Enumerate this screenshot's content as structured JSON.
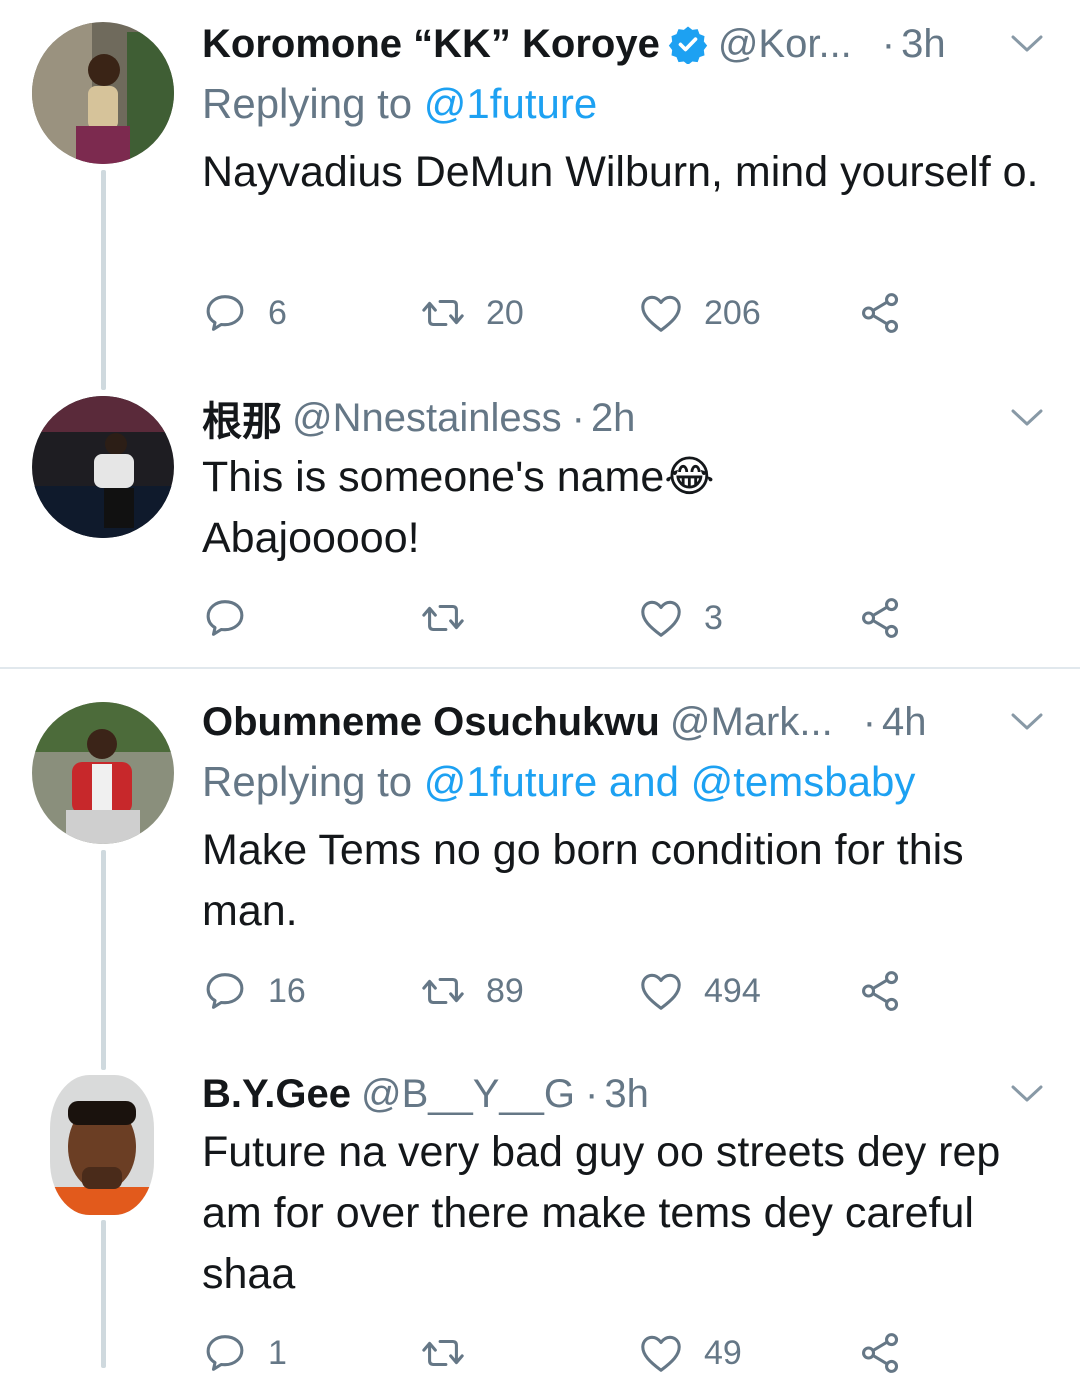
{
  "colors": {
    "accent": "#1da1f2",
    "secondary_text": "#657786",
    "primary_text": "#14171a",
    "thread_line": "#cfd9de"
  },
  "tweets": [
    {
      "name": "Koromone “KK” Koroye",
      "handle": "@Kor...",
      "sep": "·",
      "time": "3h",
      "verified": true,
      "reply_prefix": "Replying to",
      "reply_mentions": "@1future",
      "text": "Nayvadius DeMun Wilburn, mind yourself o.",
      "replies": "6",
      "retweets": "20",
      "likes": "206"
    },
    {
      "name": "根那",
      "handle": "@Nnestainless",
      "sep": "·",
      "time": "2h",
      "text_line1": "This is someone's name",
      "emoji": "😂",
      "text_line2": "Abajooooo!",
      "replies": "",
      "retweets": "",
      "likes": "3"
    },
    {
      "name": "Obumneme Osuchukwu",
      "handle": "@Mark...",
      "sep": "·",
      "time": "4h",
      "reply_prefix": "Replying to",
      "reply_mentions": "@1future and @temsbaby",
      "text": "Make Tems no go born condition for this man.",
      "replies": "16",
      "retweets": "89",
      "likes": "494"
    },
    {
      "name": "B.Y.Gee",
      "handle": "@B__Y__G",
      "sep": "·",
      "time": "3h",
      "text": "Future na very bad guy oo streets dey rep am for over there make tems dey careful shaa",
      "replies": "1",
      "retweets": "",
      "likes": "49"
    }
  ],
  "icons": [
    "reply-icon",
    "retweet-icon",
    "like-icon",
    "share-icon",
    "caret-down-icon",
    "verified-badge-icon"
  ]
}
